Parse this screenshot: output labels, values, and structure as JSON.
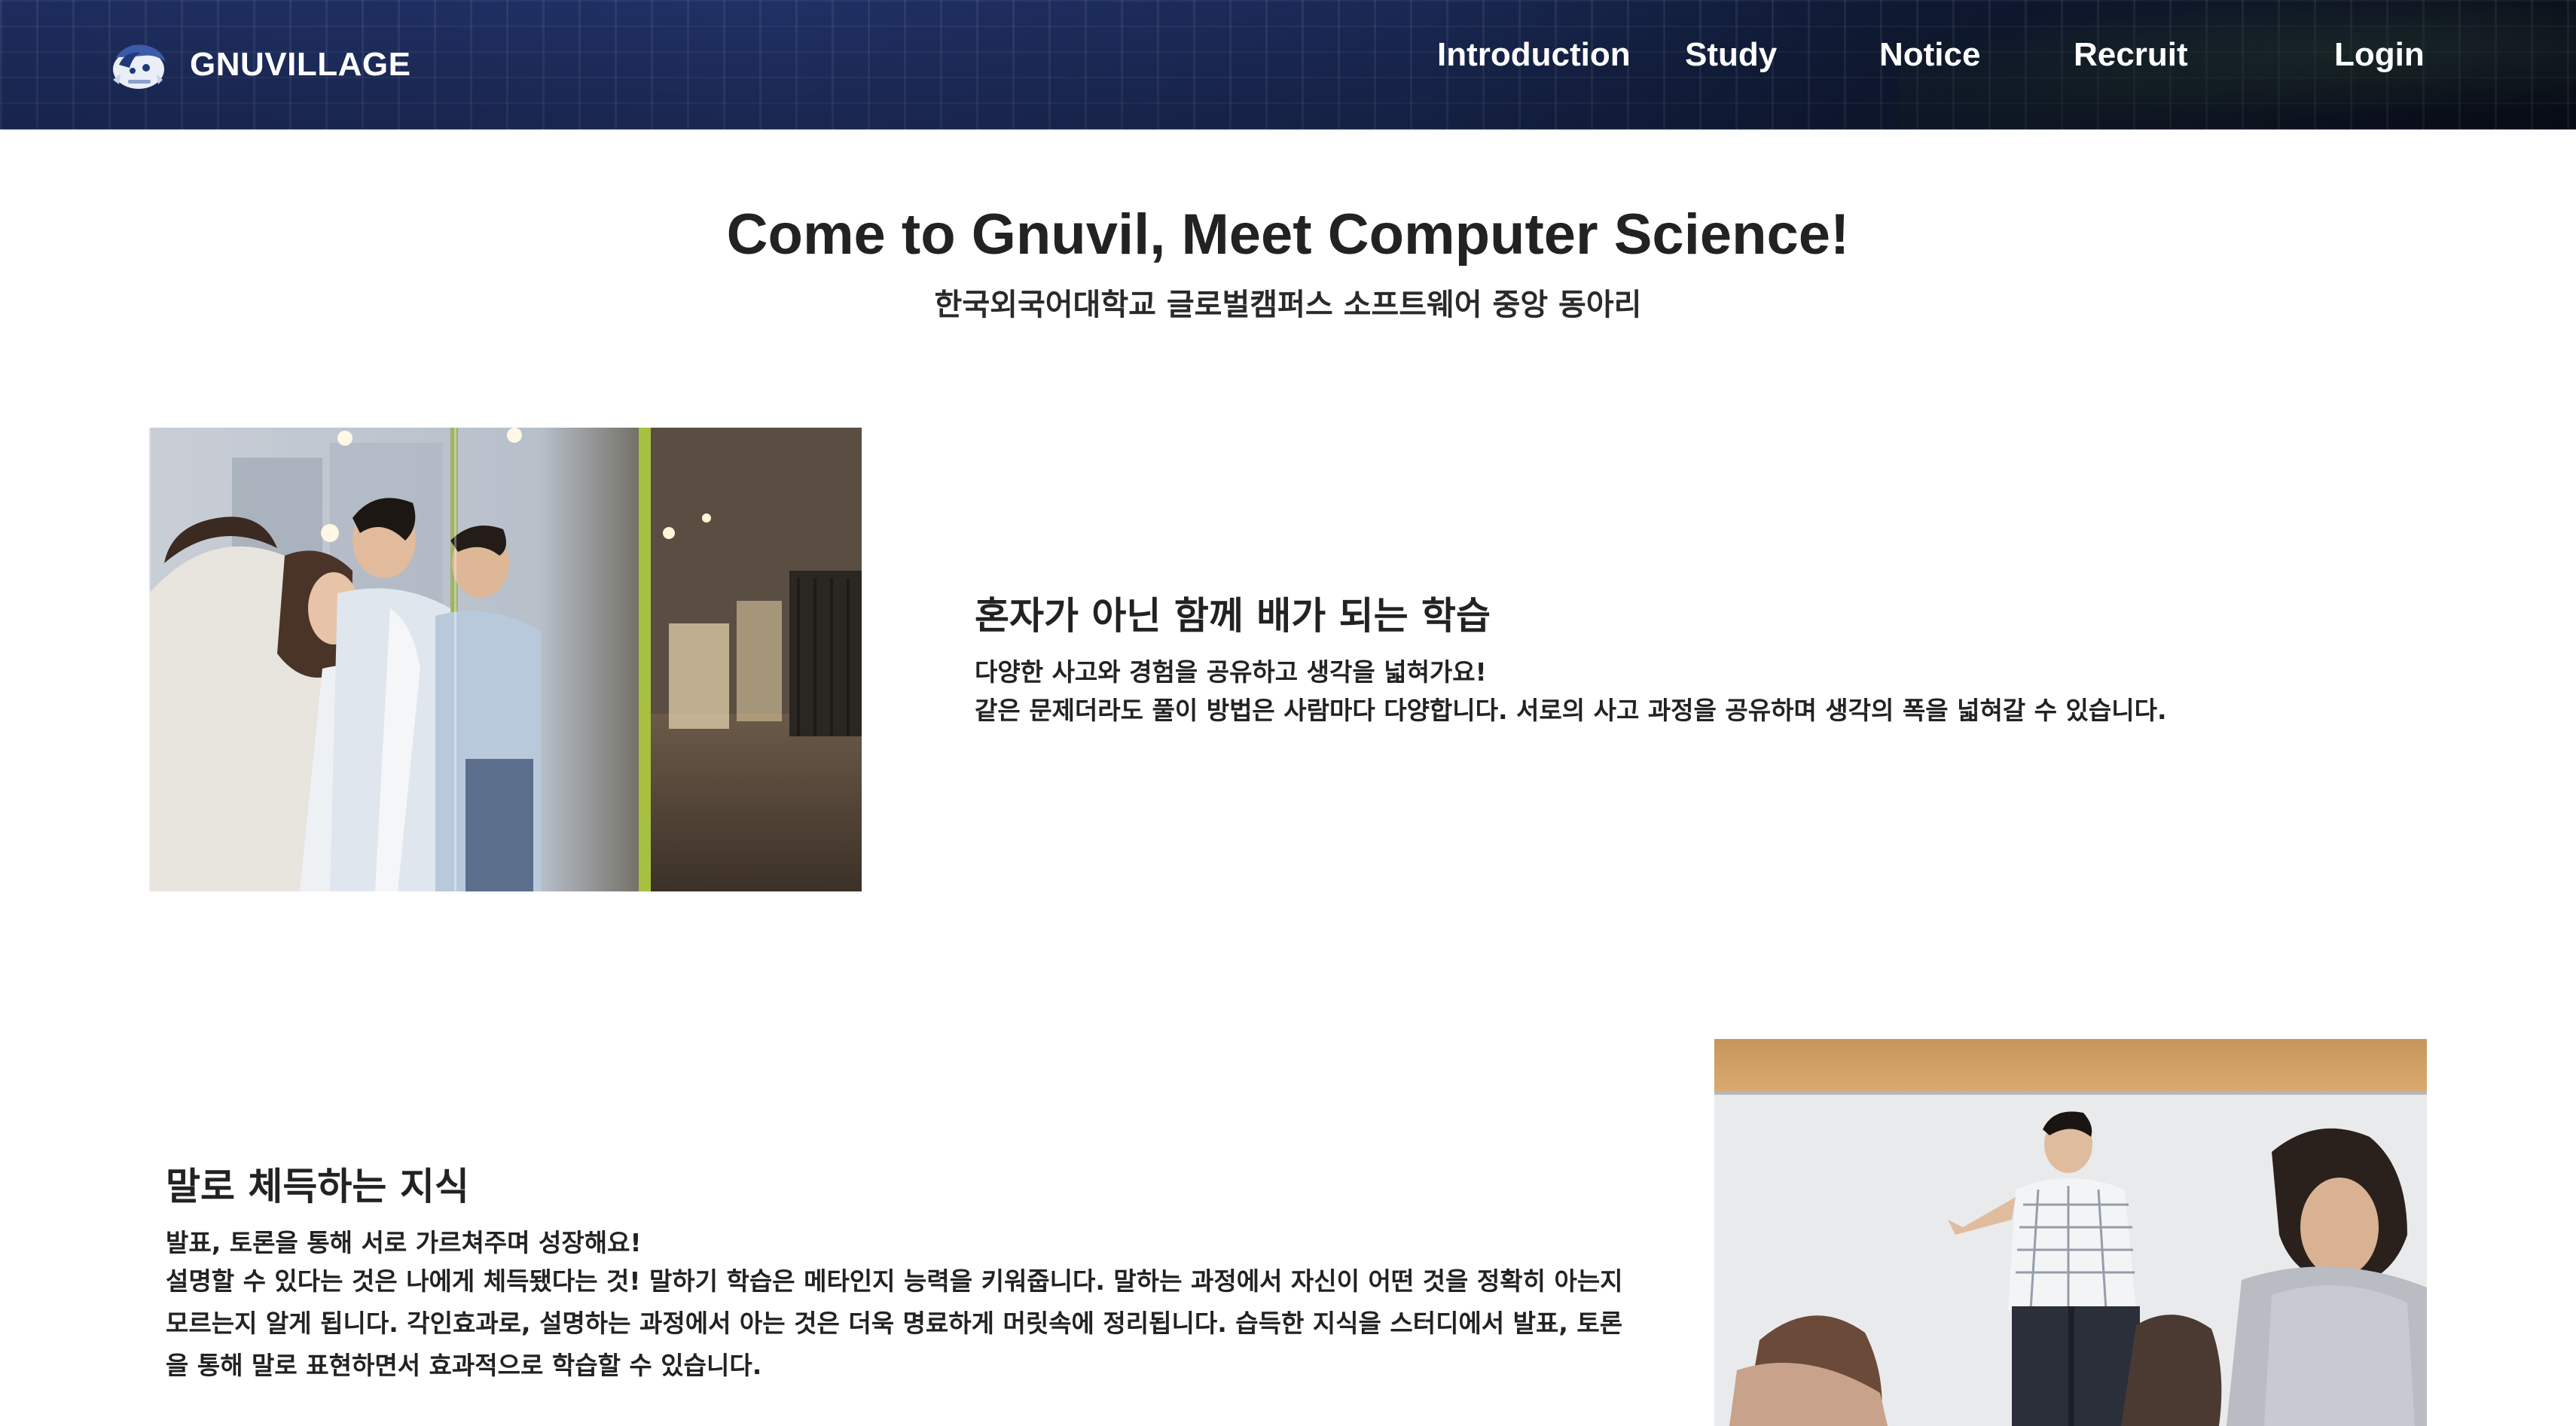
{
  "header": {
    "brand": "GNUVILLAGE",
    "logo_icon": "gnuvillage-logo",
    "nav": [
      {
        "label": "Introduction"
      },
      {
        "label": "Study"
      },
      {
        "label": "Notice"
      },
      {
        "label": "Recruit"
      }
    ],
    "login_label": "Login"
  },
  "hero": {
    "title": "Come to Gnuvil, Meet Computer Science!",
    "subtitle": "한국외국어대학교 글로벌캠퍼스 소프트웨어 중앙 동아리"
  },
  "features": [
    {
      "title": "혼자가 아닌 함께 배가 되는 학습",
      "lead": "다양한 사고와 경험을 공유하고 생각을 넓혀가요!",
      "body": "같은 문제더라도 풀이 방법은 사람마다 다양합니다. 서로의 사고 과정을 공유하며 생각의 폭을 넓혀갈 수 있습니다."
    },
    {
      "title": "말로 체득하는 지식",
      "lead": "발표, 토론을 통해 서로 가르쳐주며 성장해요!",
      "body": "설명할 수 있다는 것은 나에게 체득됐다는 것! 말하기 학습은 메타인지 능력을 키워줍니다. 말하는 과정에서 자신이 어떤 것을 정확히 아는지 모르는지 알게 됩니다. 각인효과로, 설명하는 과정에서 아는 것은 더욱 명료하게 머릿속에 정리됩니다. 습득한 지식을 스터디에서 발표, 토론을 통해 말로 표현하면서 효과적으로 학습할 수 있습니다."
    }
  ],
  "colors": {
    "header_dark": "#0a0f1c",
    "header_blue": "#22336a",
    "text": "#222222",
    "background": "#ffffff"
  }
}
